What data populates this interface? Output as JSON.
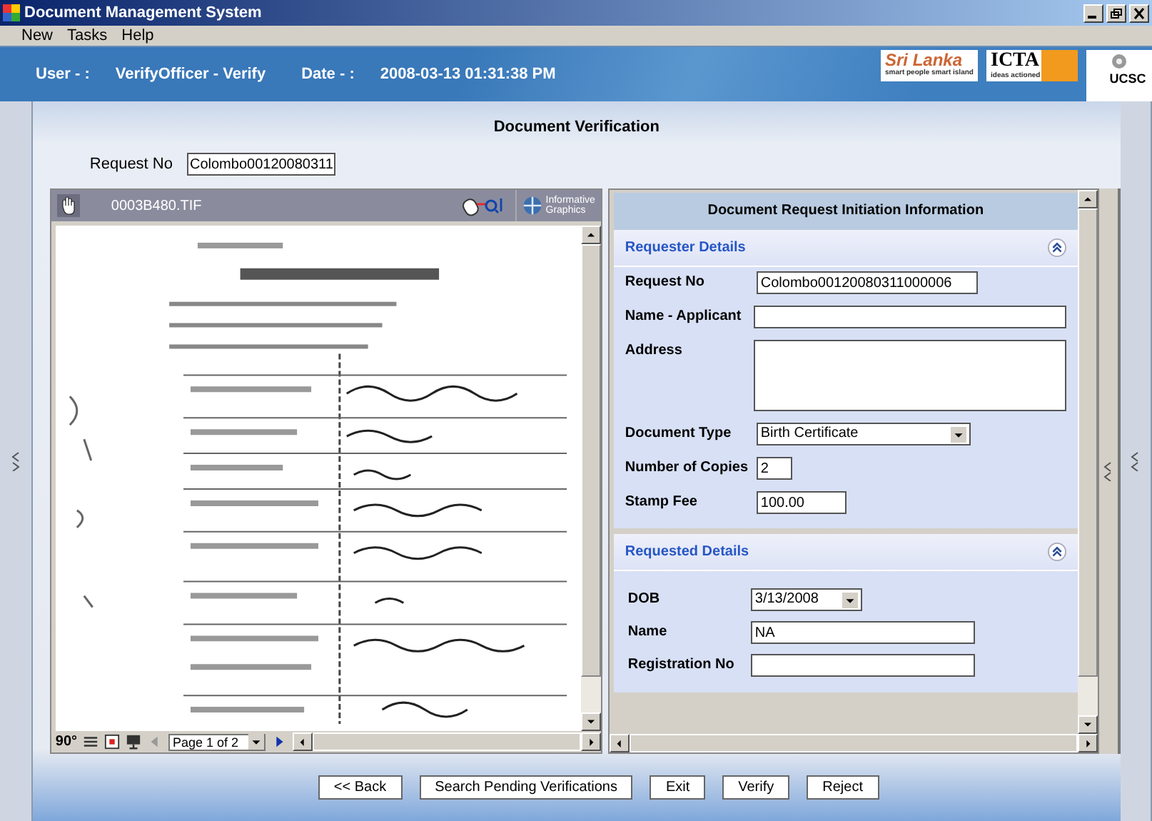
{
  "window": {
    "title": "Document Management System"
  },
  "menu": [
    "New",
    "Tasks",
    "Help"
  ],
  "header": {
    "user_label": "User - :",
    "user": "VerifyOfficer - Verify",
    "date_label": "Date - :",
    "date": "2008-03-13  01:31:38 PM"
  },
  "logos": [
    {
      "kind": "esl",
      "text": "Sri Lanka",
      "tagline": "smart people smart island"
    },
    {
      "kind": "icta",
      "text": "ICTA",
      "tagline": "ideas actioned"
    },
    {
      "kind": "ucsc",
      "text": "UCSC"
    }
  ],
  "page_title": "Document Verification",
  "request_no": {
    "label": "Request No",
    "value": "Colombo00120080311"
  },
  "viewer": {
    "filename": "0003B480.TIF",
    "brand": [
      "Informative",
      "Graphics"
    ],
    "rotate": "90°",
    "page": "Page 1 of 2"
  },
  "form": {
    "title": "Document Request Initiation Information",
    "sections": [
      {
        "title": "Requester Details",
        "expanded": true,
        "fields": [
          {
            "kind": "text",
            "label": "Request No",
            "value": "Colombo00120080311000006"
          },
          {
            "kind": "text",
            "label": "Name - Applicant"
          },
          {
            "kind": "textarea",
            "label": "Address"
          },
          {
            "kind": "select",
            "label": "Document Type",
            "value": "Birth Certificate"
          },
          {
            "kind": "text",
            "label": "Number of Copies",
            "value": "2"
          },
          {
            "kind": "text",
            "label": "Stamp Fee",
            "value": "100.00"
          }
        ]
      },
      {
        "title": "Requested Details",
        "expanded": true,
        "fields": [
          {
            "kind": "select",
            "label": "DOB",
            "value": "3/13/2008"
          },
          {
            "kind": "text",
            "label": "Name",
            "value": "NA"
          },
          {
            "kind": "text",
            "label": "Registration No"
          }
        ]
      }
    ]
  },
  "buttons": [
    "<< Back",
    "Search Pending Verifications",
    "Exit",
    "Verify",
    "Reject"
  ]
}
